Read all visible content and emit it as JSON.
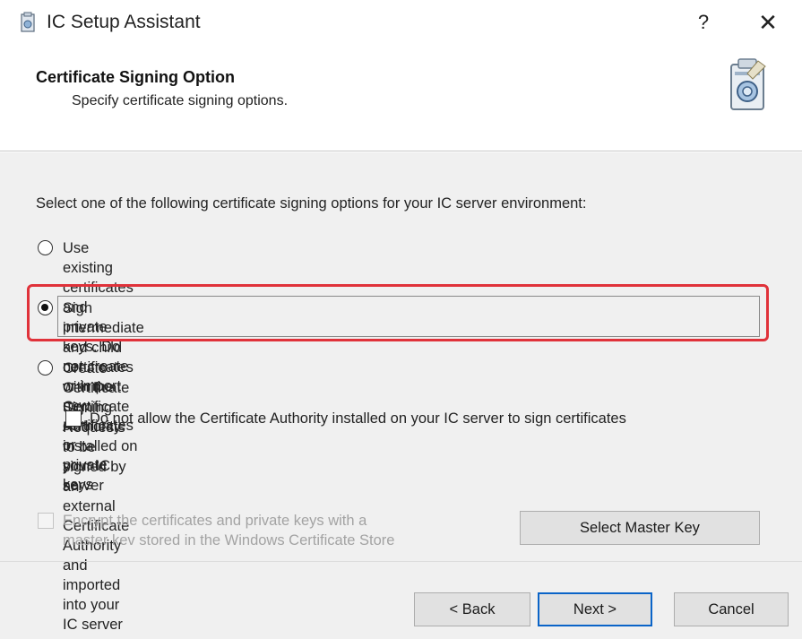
{
  "window": {
    "title": "IC Setup Assistant",
    "help_label": "?",
    "close_label": "✕"
  },
  "header": {
    "title": "Certificate Signing Option",
    "subtitle": "Specify certificate signing options."
  },
  "body": {
    "prompt": "Select one of the following certificate signing options for your IC server environment:",
    "options": [
      {
        "line1": "Use existing certificates and private keys. Do not create or import new certificates or",
        "line2": "private keys",
        "selected": false
      },
      {
        "line1": "Sign intermediate and child certificates with the Certificate Authority installed on your IC",
        "line2": "server",
        "selected": true
      },
      {
        "line1": "Create Certificate Signing Requests to be signed by an external Certificate Authority and",
        "line2": "imported into your IC server",
        "selected": false
      }
    ],
    "no_ca_sign_checkbox": {
      "label": "Do not allow the Certificate Authority installed on your IC server to sign certificates",
      "checked": false
    },
    "encrypt_checkbox": {
      "line1": "Encrypt the certificates and private keys with a",
      "line2": "master kev stored in the Windows Certificate Store",
      "checked": false,
      "enabled": false
    },
    "select_master_key_label": "Select Master Key"
  },
  "footer": {
    "back_label": "< Back",
    "next_label": "Next >",
    "cancel_label": "Cancel"
  },
  "colors": {
    "highlight": "#e0323a",
    "default_button_border": "#0a64c8",
    "body_bg": "#f0f0f0"
  }
}
